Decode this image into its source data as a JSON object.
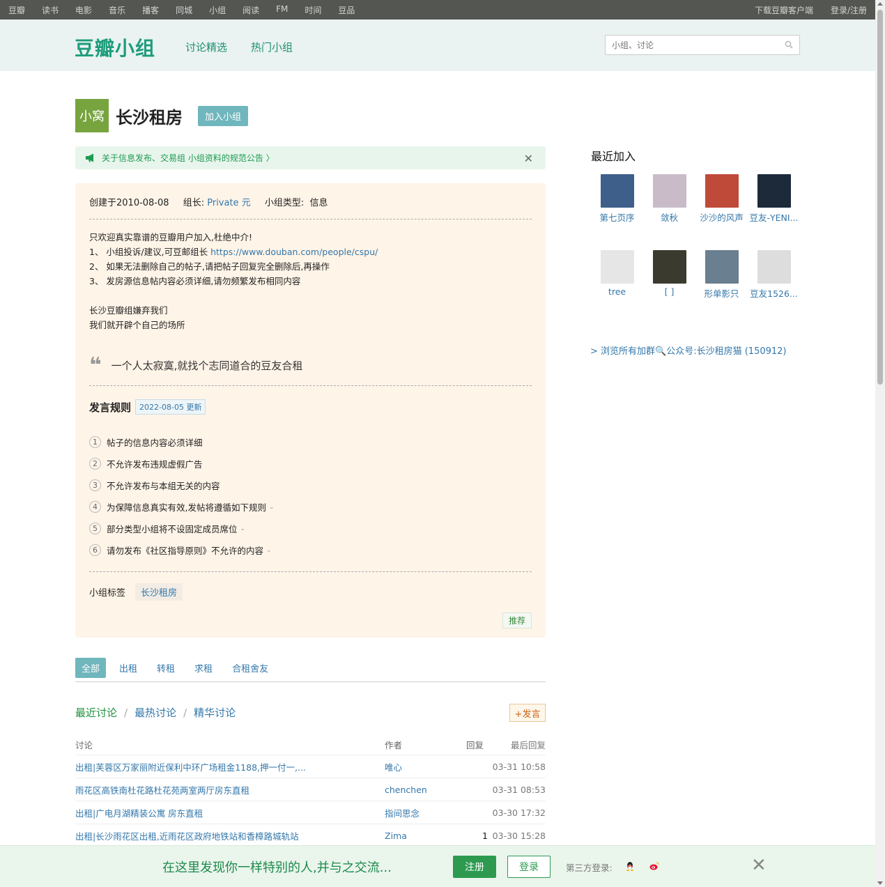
{
  "topnav": {
    "left": [
      "豆瓣",
      "读书",
      "电影",
      "音乐",
      "播客",
      "同城",
      "小组",
      "阅读",
      "FM",
      "时间",
      "豆品"
    ],
    "right": [
      "下载豆瓣客户端",
      "登录/注册"
    ]
  },
  "header": {
    "logo": "豆瓣小组",
    "nav": [
      "讨论精选",
      "热门小组"
    ],
    "search_placeholder": "小组、讨论"
  },
  "group": {
    "avatar_text": "小窝",
    "name": "长沙租房",
    "join_label": "加入小组"
  },
  "notice": {
    "text": "关于信息发布、交易组 小组资料的规范公告 〉",
    "close": "✕"
  },
  "info": {
    "created": "创建于2010-08-08",
    "owner_label": "组长:",
    "owner": "Private 元",
    "type_label": "小组类型:",
    "type": "信息",
    "intro_lines": [
      "只欢迎真实靠谱的豆瓣用户加入,杜绝中介!",
      "1、 小组投诉/建议,可豆邮组长 ",
      "2、 如果无法删除自己的帖子,请把帖子回复完全删除后,再操作",
      "3、 发房源信息帖内容必须详细,请勿频繁发布相同内容",
      "",
      "长沙豆瓣组嫌弃我们",
      "我们就开辟个自己的场所"
    ],
    "intro_link": "https://www.douban.com/people/cspu/",
    "quote": "一个人太寂寞,就找个志同道合的豆友合租",
    "rules_title": "发言规则",
    "rules_tag": "2022-08-05 更新",
    "rules": [
      {
        "num": "1",
        "text": "帖子的信息内容必须详细",
        "expand": false
      },
      {
        "num": "2",
        "text": "不允许发布违规虚假广告",
        "expand": false
      },
      {
        "num": "3",
        "text": "不允许发布与本组无关的内容",
        "expand": false
      },
      {
        "num": "4",
        "text": "为保障信息真实有效,发帖将遵循如下规则",
        "expand": true
      },
      {
        "num": "5",
        "text": "部分类型小组将不设固定成员席位",
        "expand": true
      },
      {
        "num": "6",
        "text": "请勿发布《社区指导原则》不允许的内容",
        "expand": true
      }
    ],
    "tags_label": "小组标签",
    "tag": "长沙租房",
    "recommend": "推荐"
  },
  "tabs": [
    "全部",
    "出租",
    "转租",
    "求租",
    "合租舍友"
  ],
  "sorts": [
    "最近讨论",
    "最热讨论",
    "精华讨论"
  ],
  "post_label": "+发言",
  "table": {
    "headers": [
      "讨论",
      "作者",
      "回复",
      "最后回复"
    ],
    "rows": [
      {
        "title": "出租|芙蓉区万家丽附近保利中环广场租金1188,押一付一,...",
        "author": "唯心",
        "replies": "",
        "last": "03-31 10:58"
      },
      {
        "title": "雨花区高铁南杜花路杜花苑两室两厅房东直租",
        "author": "chenchen",
        "replies": "",
        "last": "03-31 08:53"
      },
      {
        "title": "出租|广电月湖精装公寓 房东直租",
        "author": "指间思念",
        "replies": "",
        "last": "03-30 17:32"
      },
      {
        "title": "出租|长沙雨花区出租,近雨花区政府地铁站和香樟路城轨站",
        "author": "Zima",
        "replies": "1",
        "last": "03-30 15:28"
      }
    ]
  },
  "sidebar": {
    "title": "最近加入",
    "members": [
      {
        "name": "第七页序",
        "color": "#3d5f8a"
      },
      {
        "name": "敛秋",
        "color": "#c9bcc8"
      },
      {
        "name": "沙沙的风声",
        "color": "#c04a3a"
      },
      {
        "name": "豆友-YENI...",
        "color": "#1c2a3a"
      },
      {
        "name": "tree",
        "color": "#e6e6e6"
      },
      {
        "name": "[ ]",
        "color": "#3a3a2e"
      },
      {
        "name": "形单影只",
        "color": "#6a7f8f"
      },
      {
        "name": "豆友1526...",
        "color": "#dddddd"
      }
    ],
    "browse": "> 浏览所有加群🔍公众号:长沙租房猫 (150912)"
  },
  "banner": {
    "message": "在这里发现你一样特别的人,并与之交流...",
    "register": "注册",
    "login": "登录",
    "third": "第三方登录:",
    "close": "✕"
  },
  "colors": {
    "accent": "#1e9c7c",
    "link": "#3377aa",
    "join": "#70b6bd",
    "info_bg": "#fff4e8",
    "banner_green": "#2d9a50"
  }
}
